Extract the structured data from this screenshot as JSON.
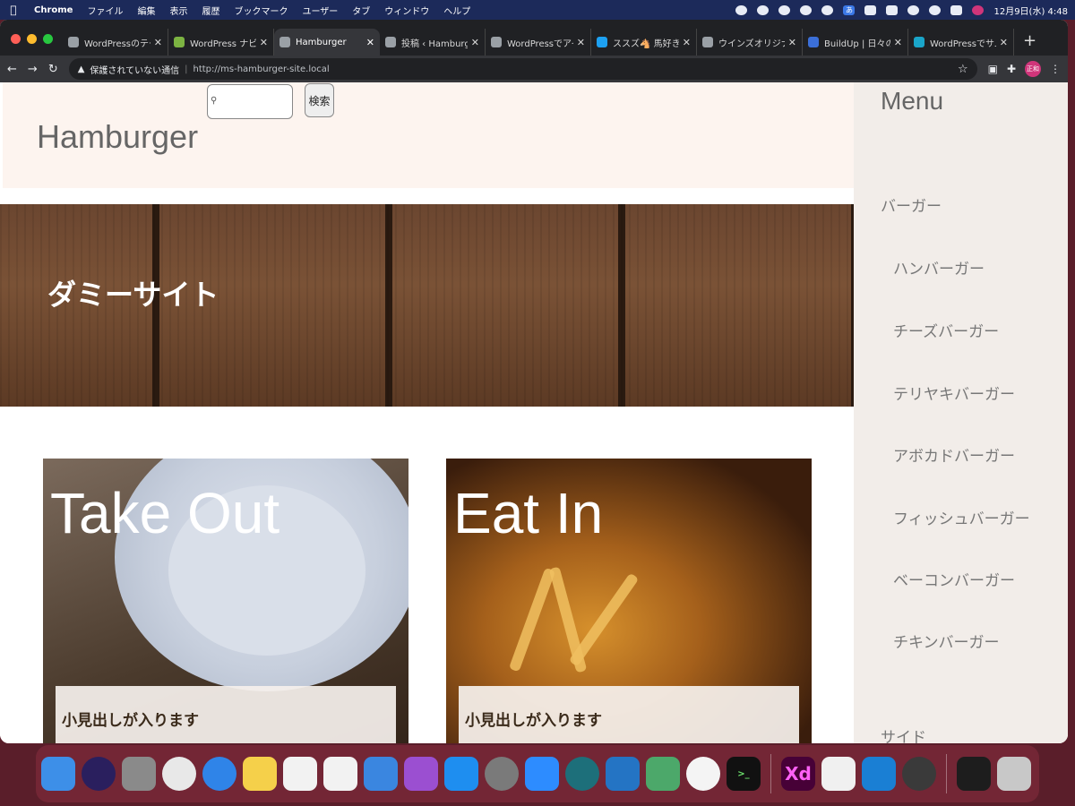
{
  "menubar": {
    "app": "Chrome",
    "items": [
      "ファイル",
      "編集",
      "表示",
      "履歴",
      "ブックマーク",
      "ユーザー",
      "タブ",
      "ウィンドウ",
      "ヘルプ"
    ],
    "input_method": "あ",
    "clock": "12月9日(水) 4:48"
  },
  "tabs": [
    {
      "label": "WordPressのテーマ"
    },
    {
      "label": "WordPress ナビゲ"
    },
    {
      "label": "Hamburger"
    },
    {
      "label": "投稿 ‹ Hamburger"
    },
    {
      "label": "WordPressでアイ"
    },
    {
      "label": "ススズ🐴 馬好き"
    },
    {
      "label": "ウインズオリジナル"
    },
    {
      "label": "BuildUp | 日々の覚"
    },
    {
      "label": "WordPressでサム"
    }
  ],
  "toolbar": {
    "security_text": "保護されていない通信",
    "url": "http://ms-hamburger-site.local",
    "profile_initials": "正和"
  },
  "page": {
    "site_title": "Hamburger",
    "search_button": "検索",
    "hero_text": "ダミーサイト",
    "cards": [
      {
        "title": "Take Out",
        "caption": "小見出しが入ります"
      },
      {
        "title": "Eat In",
        "caption": "小見出しが入ります"
      }
    ]
  },
  "sidebar": {
    "heading": "Menu",
    "category": "バーガー",
    "items": [
      "ハンバーガー",
      "チーズバーガー",
      "テリヤキバーガー",
      "アボカドバーガー",
      "フィッシュバーガー",
      "ベーコンバーガー",
      "チキンバーガー"
    ],
    "footer": "サイド"
  },
  "dock": {
    "icons": [
      "finder-icon",
      "siri-icon",
      "launchpad-icon",
      "chrome-icon",
      "safari-icon",
      "notes-icon",
      "reminders-icon",
      "numbers-icon",
      "keynote-icon",
      "podcasts-icon",
      "app-store-icon",
      "system-preferences-icon",
      "zoom-icon",
      "telegram-icon",
      "vscode-icon",
      "gitkraken-icon",
      "slack-icon",
      "terminal-icon",
      "adobe-xd-icon",
      "textedit-icon",
      "vscode-insiders-icon",
      "quicktime-icon",
      "folder-icon",
      "trash-icon"
    ],
    "xd_label": "Xd",
    "terminal_label": ">_"
  }
}
